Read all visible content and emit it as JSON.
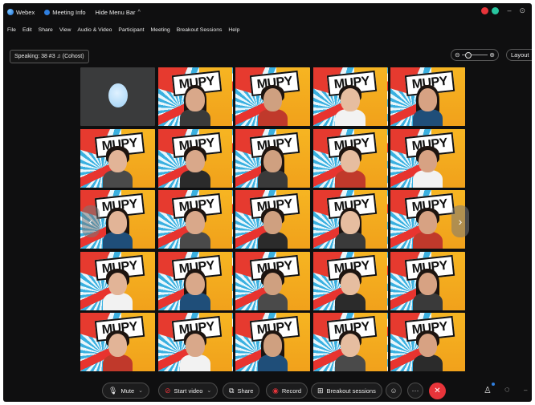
{
  "titlebar": {
    "app_name": "Webex",
    "meeting_info": "Meeting Info",
    "hide_menu_bar": "Hide Menu Bar",
    "caret": "^",
    "minimize": "–",
    "restore": "⊙"
  },
  "menu": [
    "File",
    "Edit",
    "Share",
    "View",
    "Audio & Video",
    "Participant",
    "Meeting",
    "Breakout Sessions",
    "Help"
  ],
  "speaking": "Speaking: 38 #3 ♫ (Cohost)",
  "zoom": {
    "minus": "⊖",
    "plus": "⊕"
  },
  "layout_label": "Layout",
  "logo_text": "MUPY",
  "nav": {
    "prev": "‹",
    "next": "›"
  },
  "controls": {
    "mute_label": "Mute",
    "start_video_label": "Start video",
    "share_label": "Share",
    "record_label": "Record",
    "breakout_label": "Breakout sessions",
    "chevron": "⌄",
    "more": "···",
    "end": "✕"
  },
  "colors": {
    "accent_red": "#e8343a",
    "bg_yellow": "#f5b323",
    "bg_blue": "#3ab0e0",
    "window_bg": "#0f0f10"
  }
}
